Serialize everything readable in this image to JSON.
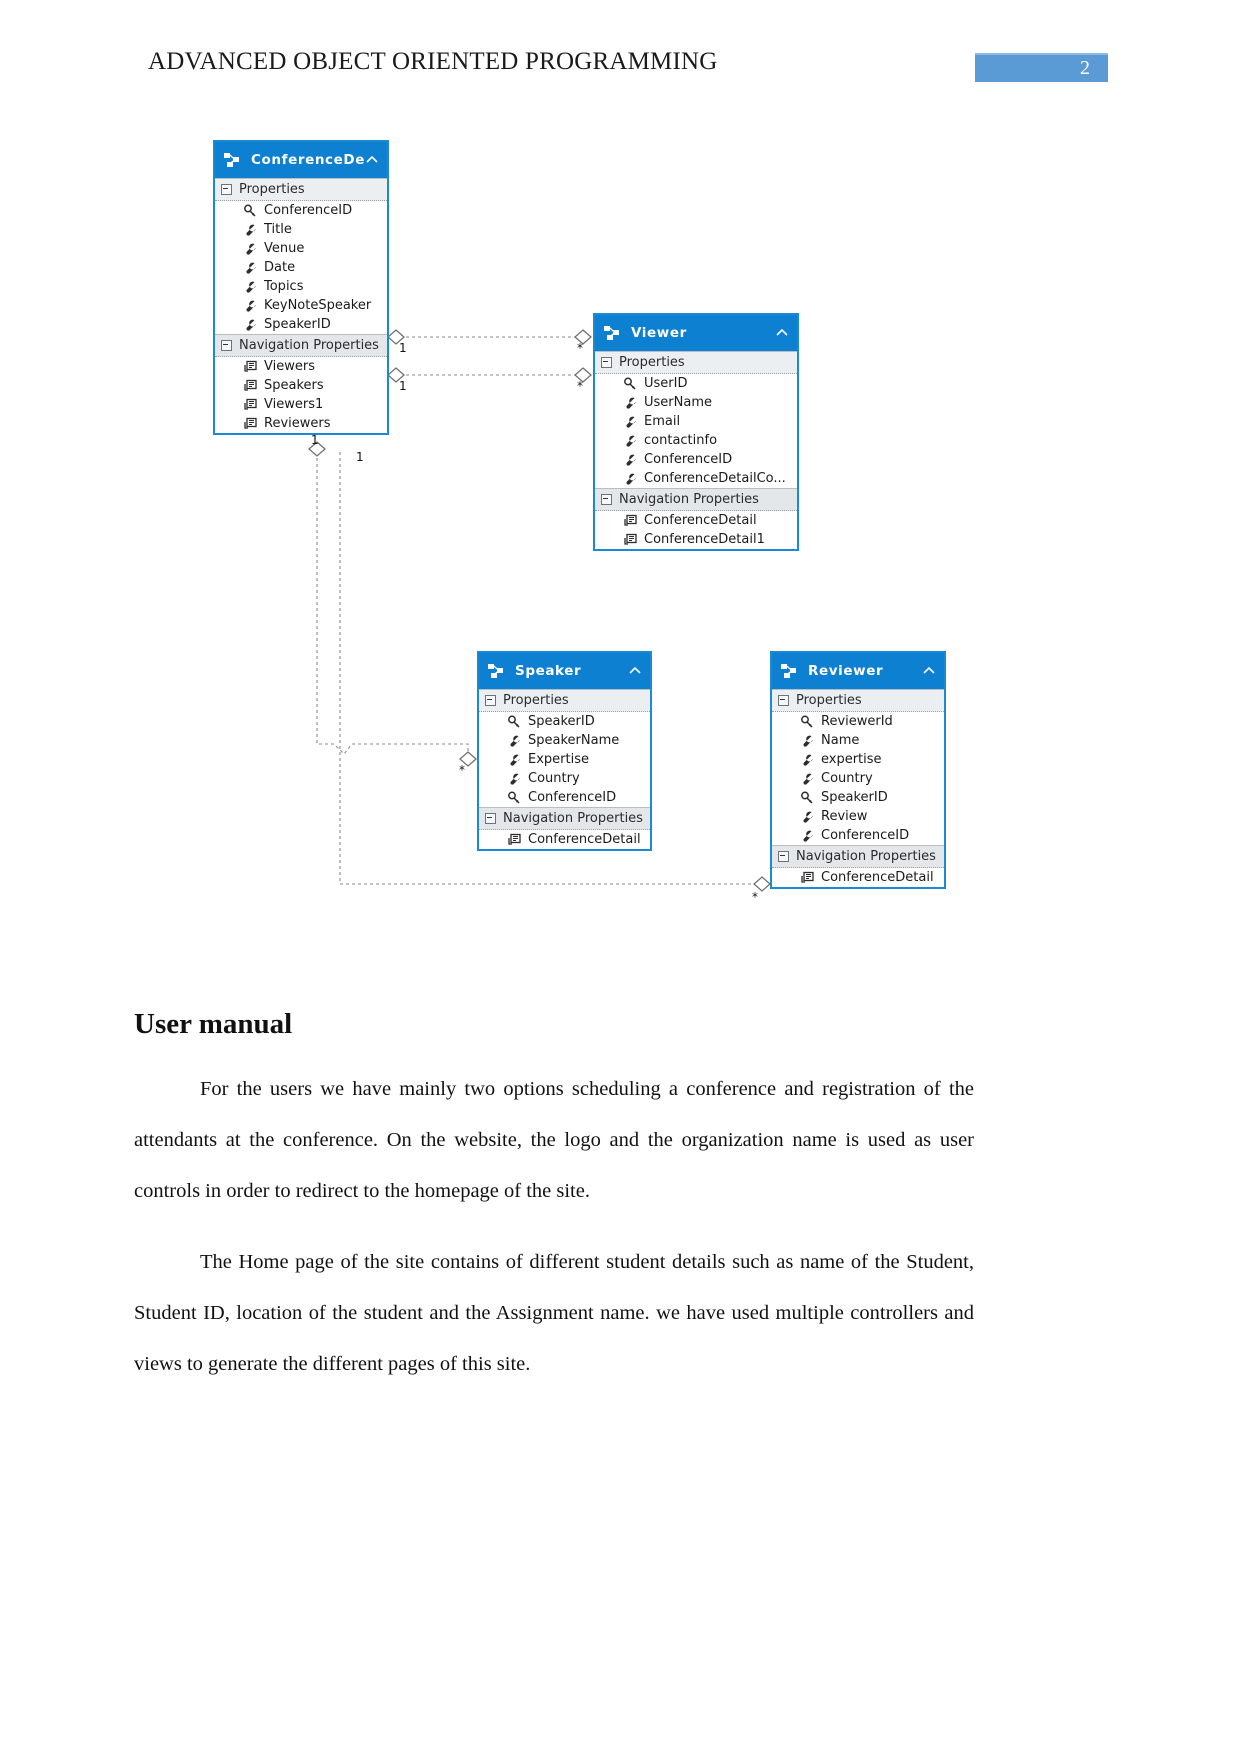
{
  "header": {
    "title": "ADVANCED OBJECT ORIENTED PROGRAMMING",
    "page_number": "2",
    "badge_color": "#5b9bd5"
  },
  "diagram": {
    "type": "entity-relationship-class-diagram",
    "accent_color": "#0e80d2",
    "entities": [
      {
        "id": "conference-detail",
        "title": "ConferenceDe...",
        "sections": [
          {
            "label": "Properties",
            "rows": [
              {
                "name": "ConferenceID",
                "icon": "key-icon"
              },
              {
                "name": "Title",
                "icon": "wrench-icon"
              },
              {
                "name": "Venue",
                "icon": "wrench-icon"
              },
              {
                "name": "Date",
                "icon": "wrench-icon"
              },
              {
                "name": "Topics",
                "icon": "wrench-icon"
              },
              {
                "name": "KeyNoteSpeaker",
                "icon": "wrench-icon"
              },
              {
                "name": "SpeakerID",
                "icon": "wrench-icon"
              }
            ]
          },
          {
            "label": "Navigation Properties",
            "rows": [
              {
                "name": "Viewers",
                "icon": "navigation-icon"
              },
              {
                "name": "Speakers",
                "icon": "navigation-icon"
              },
              {
                "name": "Viewers1",
                "icon": "navigation-icon"
              },
              {
                "name": "Reviewers",
                "icon": "navigation-icon"
              }
            ]
          }
        ]
      },
      {
        "id": "viewer",
        "title": "Viewer",
        "sections": [
          {
            "label": "Properties",
            "rows": [
              {
                "name": "UserID",
                "icon": "key-icon"
              },
              {
                "name": "UserName",
                "icon": "wrench-icon"
              },
              {
                "name": "Email",
                "icon": "wrench-icon"
              },
              {
                "name": "contactinfo",
                "icon": "wrench-icon"
              },
              {
                "name": "ConferenceID",
                "icon": "wrench-icon"
              },
              {
                "name": "ConferenceDetailCo...",
                "icon": "wrench-icon"
              }
            ]
          },
          {
            "label": "Navigation Properties",
            "rows": [
              {
                "name": "ConferenceDetail",
                "icon": "navigation-icon"
              },
              {
                "name": "ConferenceDetail1",
                "icon": "navigation-icon"
              }
            ]
          }
        ]
      },
      {
        "id": "speaker",
        "title": "Speaker",
        "sections": [
          {
            "label": "Properties",
            "rows": [
              {
                "name": "SpeakerID",
                "icon": "key-icon"
              },
              {
                "name": "SpeakerName",
                "icon": "wrench-icon"
              },
              {
                "name": "Expertise",
                "icon": "wrench-icon"
              },
              {
                "name": "Country",
                "icon": "wrench-icon"
              },
              {
                "name": "ConferenceID",
                "icon": "key-icon"
              }
            ]
          },
          {
            "label": "Navigation Properties",
            "rows": [
              {
                "name": "ConferenceDetail",
                "icon": "navigation-icon"
              }
            ]
          }
        ]
      },
      {
        "id": "reviewer",
        "title": "Reviewer",
        "sections": [
          {
            "label": "Properties",
            "rows": [
              {
                "name": "ReviewerId",
                "icon": "key-icon"
              },
              {
                "name": "Name",
                "icon": "wrench-icon"
              },
              {
                "name": "expertise",
                "icon": "wrench-icon"
              },
              {
                "name": "Country",
                "icon": "wrench-icon"
              },
              {
                "name": "SpeakerID",
                "icon": "key-icon"
              },
              {
                "name": "Review",
                "icon": "wrench-icon"
              },
              {
                "name": "ConferenceID",
                "icon": "wrench-icon"
              }
            ]
          },
          {
            "label": "Navigation Properties",
            "rows": [
              {
                "name": "ConferenceDetail",
                "icon": "navigation-icon"
              }
            ]
          }
        ]
      }
    ],
    "associations": [
      {
        "from": "conference-detail",
        "to": "viewer",
        "from_multiplicity": "1",
        "to_multiplicity": "*"
      },
      {
        "from": "conference-detail",
        "to": "viewer",
        "from_multiplicity": "1",
        "to_multiplicity": "*"
      },
      {
        "from": "conference-detail",
        "to": "speaker",
        "from_multiplicity": "1",
        "to_multiplicity": "*"
      },
      {
        "from": "conference-detail",
        "to": "reviewer",
        "from_multiplicity": "1",
        "to_multiplicity": "*"
      }
    ]
  },
  "body": {
    "heading": "User manual",
    "paragraph_1": "For the users we have mainly two options scheduling a conference and registration of the attendants at the conference. On the website, the logo and the organization name is used as user controls in order to redirect to the homepage of the site.",
    "paragraph_2": "The Home page of the site contains of different student details such as name of the Student, Student ID, location of the student and the Assignment name. we have used multiple controllers and views to generate the different pages of this site."
  }
}
